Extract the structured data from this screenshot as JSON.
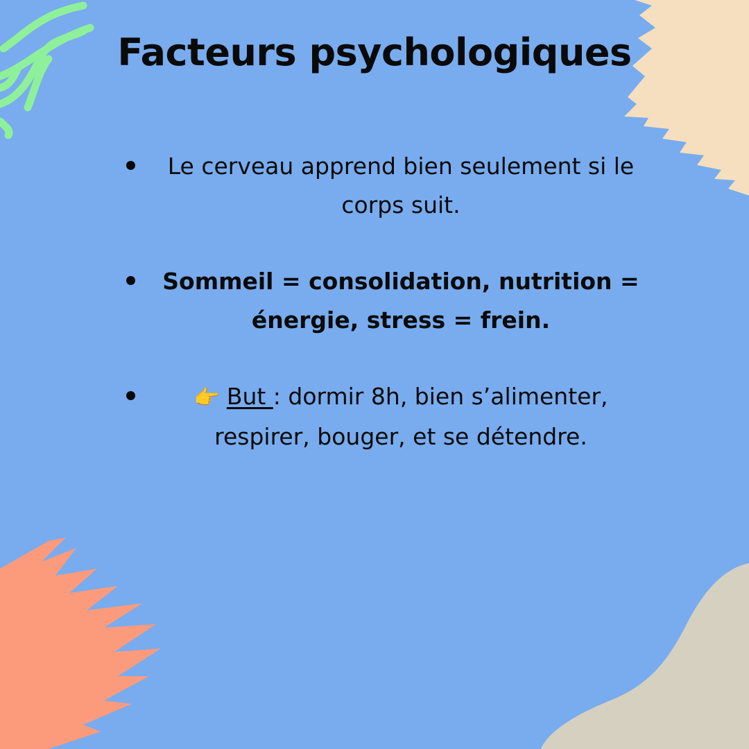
{
  "title": "Facteurs psychologiques",
  "points": [
    {
      "text": "Le cerveau apprend bien seulement si le corps suit."
    },
    {
      "text": "Sommeil = consolidation, nutrition = énergie, stress = frein."
    },
    {
      "icon": "pointing-hand-icon",
      "label": "But ",
      "separator": ": ",
      "text": "dormir 8h, bien s’alimenter, respirer, bouger, et se détendre."
    }
  ],
  "colors": {
    "background": "#78acee",
    "green_stroke": "#8ff09a",
    "cream_shape": "#f5dfbf",
    "salmon_shape": "#fc9b7b",
    "beige_shape": "#d6d0c0",
    "hand_icon": "#f6c63d"
  }
}
